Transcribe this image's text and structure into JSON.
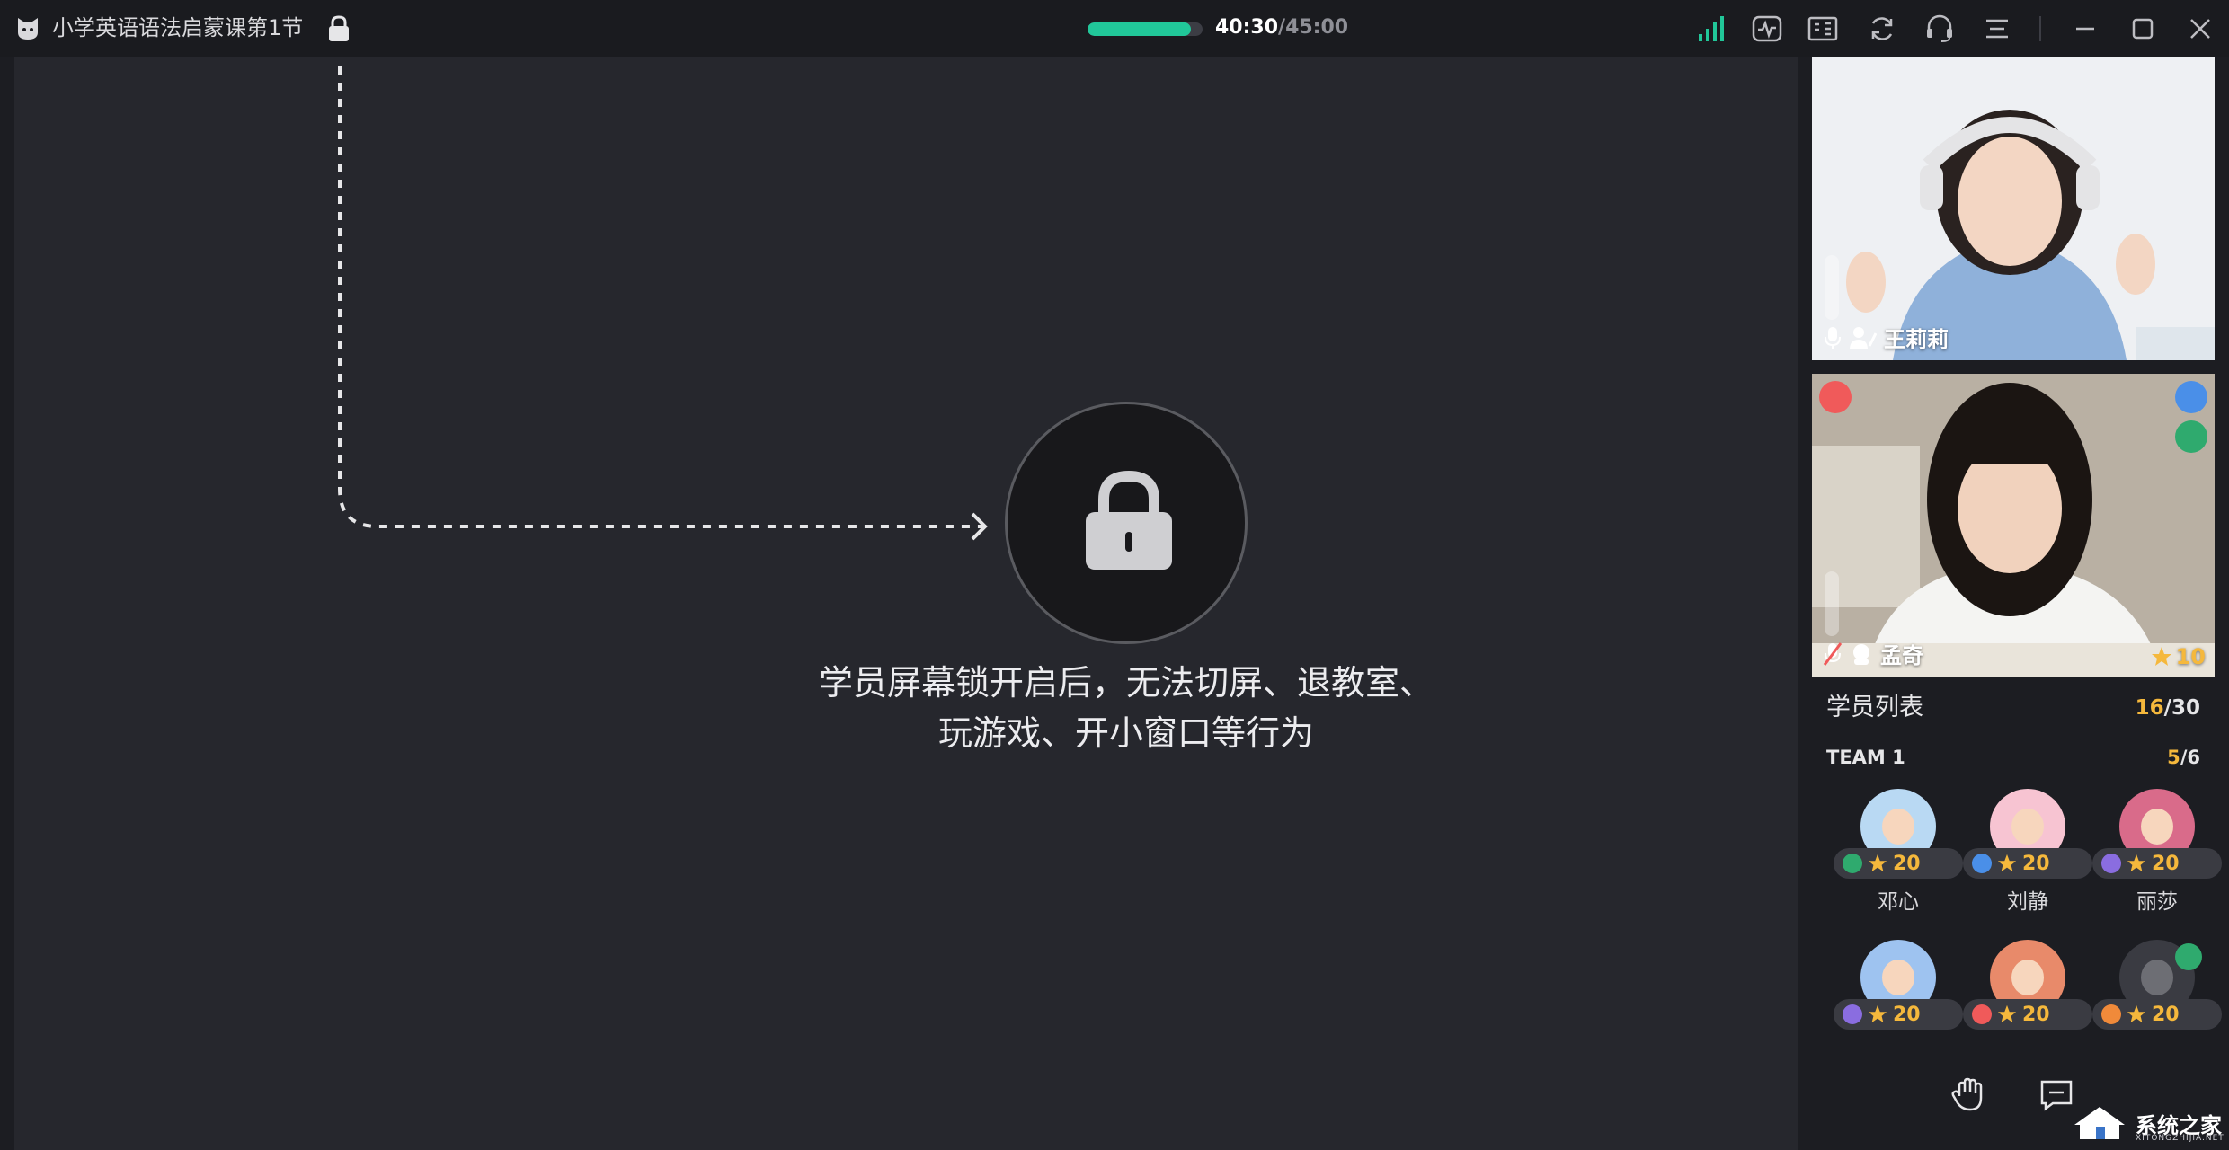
{
  "window": {
    "title": "小学英语语法启蒙课第1节",
    "timer_current": "40:30",
    "timer_total": "/45:00",
    "progress_fraction": 0.9,
    "accent": "#21c799"
  },
  "toolbar": {
    "icons": [
      "signal-icon",
      "activity-icon",
      "id-card-icon",
      "refresh-icon",
      "headset-icon",
      "menu-icon"
    ],
    "window_controls": [
      "minimize-icon",
      "maximize-icon",
      "close-icon"
    ]
  },
  "stage": {
    "lock_message_line1": "学员屏幕锁开启后，无法切屏、退教室、",
    "lock_message_line2": "玩游戏、开小窗口等行为"
  },
  "videos": {
    "teacher": {
      "name": "王莉莉"
    },
    "student": {
      "name": "孟奇",
      "stars": "10"
    }
  },
  "student_list": {
    "title": "学员列表",
    "count_online": "16",
    "count_total": "/30",
    "team_name": "TEAM 1",
    "team_online": "5",
    "team_total": "/6",
    "students": [
      {
        "name": "邓心",
        "stars": "20"
      },
      {
        "name": "刘静",
        "stars": "20"
      },
      {
        "name": "丽莎",
        "stars": "20"
      },
      {
        "name": "",
        "stars": "20"
      },
      {
        "name": "",
        "stars": "20"
      },
      {
        "name": "",
        "stars": "20"
      }
    ]
  },
  "watermark": {
    "text": "系统之家",
    "sub": "XITONGZHIJIA.NET"
  }
}
